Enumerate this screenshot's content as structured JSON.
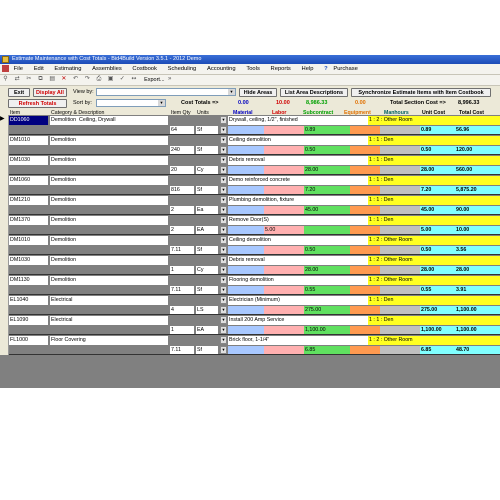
{
  "window": {
    "title": "Estimate Maintenance with Cost Totals - Bid4Build Version 3.5.1 - 2012 Demo"
  },
  "menu": [
    "File",
    "Edit",
    "Estimating",
    "Assemblies",
    "Costbook",
    "Scheduling",
    "Accounting",
    "Tools",
    "Reports",
    "Help",
    "Purchase"
  ],
  "menu_help_icon": "?",
  "toolbar": {
    "export_label": "Export..."
  },
  "controls": {
    "exit_label": "Exit",
    "display_all_label": "Display All",
    "refresh_totals_label": "Refresh Totals",
    "view_by_label": "View by:",
    "sort_by_label": "Sort by:",
    "cost_totals_label": "Cost Totals =>",
    "hide_areas_label": "Hide Areas",
    "list_area_descriptions_label": "List Area Descriptions",
    "synchronize_label": "Synchronize Estimate Items with Item Costbook",
    "totals": {
      "material": "0.00",
      "labor": "10.00",
      "subcontract": "8,986.33",
      "equipment": "0.00"
    },
    "total_section_label": "Total Section Cost =>",
    "total_section_value": "8,996.33"
  },
  "headers": {
    "item": "Item",
    "category": "Category & Description",
    "qty": "Item Qty",
    "units": "Units",
    "material": "Material",
    "labor": "Labor",
    "subcontract": "Subcontract",
    "equipment": "Equipment",
    "manhours": "Manhours",
    "unit_cost": "Unit Cost",
    "total_cost": "Total Cost"
  },
  "colors": {
    "material": "#0000c0",
    "labor": "#d00000",
    "subcontract": "#00a000",
    "equipment": "#e07000",
    "manhours": "#006060",
    "area": "#ffff20",
    "cost": "#80ffff"
  },
  "rows": [
    {
      "item": "DD1060",
      "category": "Demolition",
      "description": "Ceiling, Drywall",
      "detail": "Drywall, ceiling, 1/2\", finished",
      "area": "1 : 2 : Other Room",
      "qty": "64",
      "units": "Sf",
      "material": "",
      "labor": "",
      "subcontract": "0.89",
      "equipment": "",
      "manhours": "",
      "unit_cost": "0.89",
      "total_cost": "56.96"
    },
    {
      "item": "DM1010",
      "category": "Demolition",
      "description": "",
      "detail": "Ceiling demolition",
      "area": "1 : 1 : Den",
      "qty": "240",
      "units": "Sf",
      "material": "",
      "labor": "",
      "subcontract": "0.50",
      "equipment": "",
      "manhours": "",
      "unit_cost": "0.50",
      "total_cost": "120.00"
    },
    {
      "item": "DM1030",
      "category": "Demolition",
      "description": "",
      "detail": "Debris removal",
      "area": "1 : 1 : Den",
      "qty": "20",
      "units": "Cy",
      "material": "",
      "labor": "",
      "subcontract": "28.00",
      "equipment": "",
      "manhours": "",
      "unit_cost": "28.00",
      "total_cost": "560.00"
    },
    {
      "item": "DM1060",
      "category": "Demolition",
      "description": "",
      "detail": "Demo reinforced concrete",
      "area": "1 : 1 : Den",
      "qty": "816",
      "units": "Sf",
      "material": "",
      "labor": "",
      "subcontract": "7.20",
      "equipment": "",
      "manhours": "",
      "unit_cost": "7.20",
      "total_cost": "5,875.20"
    },
    {
      "item": "DM1210",
      "category": "Demolition",
      "description": "",
      "detail": "Plumbing demolition, fixture",
      "area": "1 : 1 : Den",
      "qty": "2",
      "units": "Ea",
      "material": "",
      "labor": "",
      "subcontract": "45.00",
      "equipment": "",
      "manhours": "",
      "unit_cost": "45.00",
      "total_cost": "90.00"
    },
    {
      "item": "DM1370",
      "category": "Demolition",
      "description": "",
      "detail": "Remove Door(S)",
      "area": "1 : 1 : Den",
      "qty": "2",
      "units": "EA",
      "material": "",
      "labor": "5.00",
      "subcontract": "",
      "equipment": "",
      "manhours": "",
      "unit_cost": "5.00",
      "total_cost": "10.00"
    },
    {
      "item": "DM1010",
      "category": "Demolition",
      "description": "",
      "detail": "Ceiling demolition",
      "area": "1 : 2 : Other Room",
      "qty": "7.11",
      "units": "Sf",
      "material": "",
      "labor": "",
      "subcontract": "0.50",
      "equipment": "",
      "manhours": "",
      "unit_cost": "0.50",
      "total_cost": "3.56"
    },
    {
      "item": "DM1030",
      "category": "Demolition",
      "description": "",
      "detail": "Debris removal",
      "area": "1 : 2 : Other Room",
      "qty": "1",
      "units": "Cy",
      "material": "",
      "labor": "",
      "subcontract": "28.00",
      "equipment": "",
      "manhours": "",
      "unit_cost": "28.00",
      "total_cost": "28.00"
    },
    {
      "item": "DM1130",
      "category": "Demolition",
      "description": "",
      "detail": "Flooring demolition",
      "area": "1 : 2 : Other Room",
      "qty": "7.11",
      "units": "Sf",
      "material": "",
      "labor": "",
      "subcontract": "0.55",
      "equipment": "",
      "manhours": "",
      "unit_cost": "0.55",
      "total_cost": "3.91"
    },
    {
      "item": "EL1040",
      "category": "Electrical",
      "description": "",
      "detail": "Electrician (Minimum)",
      "area": "1 : 1 : Den",
      "qty": "4",
      "units": "LS",
      "material": "",
      "labor": "",
      "subcontract": "275.00",
      "equipment": "",
      "manhours": "",
      "unit_cost": "275.00",
      "total_cost": "1,100.00"
    },
    {
      "item": "EL1090",
      "category": "Electrical",
      "description": "",
      "detail": "Install 200 Amp Service",
      "area": "1 : 1 : Den",
      "qty": "1",
      "units": "EA",
      "material": "",
      "labor": "",
      "subcontract": "1,100.00",
      "equipment": "",
      "manhours": "",
      "unit_cost": "1,100.00",
      "total_cost": "1,100.00"
    },
    {
      "item": "FL1000",
      "category": "Floor Covering",
      "description": "",
      "detail": "Brick floor, 1-1/4\"",
      "area": "1 : 2 : Other Room",
      "qty": "7.11",
      "units": "Sf",
      "material": "",
      "labor": "",
      "subcontract": "6.85",
      "equipment": "",
      "manhours": "",
      "unit_cost": "6.85",
      "total_cost": "48.70"
    }
  ]
}
